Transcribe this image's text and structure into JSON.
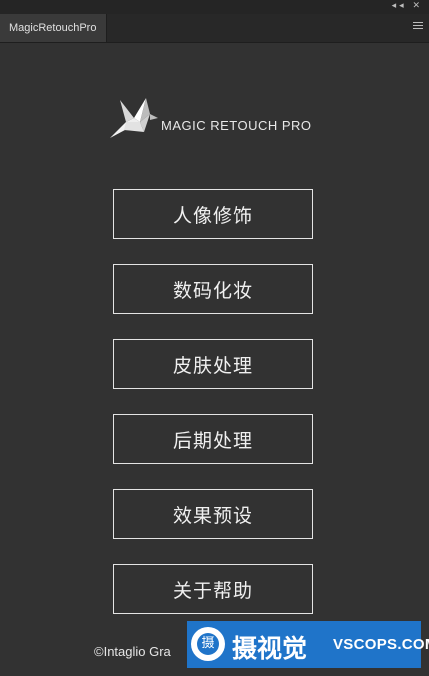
{
  "window": {
    "controls_glyph": "◂◂ ✕"
  },
  "tab": {
    "label": "MagicRetouchPro"
  },
  "panel_menu_icon": "hamburger-menu-icon",
  "logo": {
    "icon": "origami-bird-icon",
    "text": "MAGIC RETOUCH PRO"
  },
  "menu": {
    "items": [
      {
        "label": "人像修饰"
      },
      {
        "label": "数码化妆"
      },
      {
        "label": "皮肤处理"
      },
      {
        "label": "后期处理"
      },
      {
        "label": "效果预设"
      },
      {
        "label": "关于帮助"
      }
    ]
  },
  "footer": {
    "copyright": "©Intaglio Gra"
  },
  "watermark": {
    "badge_char": "摄",
    "chinese": "摄视觉",
    "english": "VSCOPS.COM",
    "color": "#1f74c9"
  }
}
